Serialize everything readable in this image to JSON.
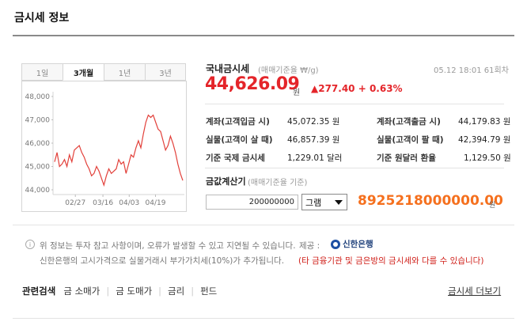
{
  "header": {
    "title": "금시세 정보"
  },
  "tabs": [
    {
      "label": "1일"
    },
    {
      "label": "3개월",
      "active": true
    },
    {
      "label": "1년"
    },
    {
      "label": "3년"
    }
  ],
  "chart_data": {
    "type": "line",
    "title": "",
    "xlabel": "",
    "ylabel": "",
    "ylim": [
      44000,
      48000
    ],
    "yticks": [
      "48,000",
      "47,000",
      "46,000",
      "45,000",
      "44,000"
    ],
    "xticks": [
      "02/27",
      "03/16",
      "04/03",
      "04/19"
    ],
    "color": "#e2403a",
    "series": [
      {
        "values": [
          45200,
          45600,
          45000,
          45100,
          45300,
          45000,
          45500,
          45200,
          45700,
          45800,
          45900,
          45600,
          45400,
          45100,
          44900,
          44600,
          44700,
          45000,
          44800,
          44500,
          44200,
          44600,
          44900,
          44700,
          44800,
          44900,
          45300,
          45100,
          45200,
          44700,
          45100,
          45500,
          45400,
          45800,
          46100,
          45800,
          46400,
          46900,
          47200,
          47100,
          47200,
          46900,
          46600,
          46500,
          46100,
          45700,
          45900,
          46300,
          46000,
          45600,
          45100,
          44700,
          44400
        ]
      }
    ]
  },
  "price": {
    "label": "국내금시세",
    "sub": "(매매기준율 ₩/g)",
    "timestamp": "05.12 18:01 61회차",
    "value": "44,626.09",
    "unit": "원",
    "change": "▲277.40 + 0.63%"
  },
  "details": [
    {
      "label": "계좌(고객입금 시)",
      "value": "45,072.35 원"
    },
    {
      "label": "계좌(고객출금 시)",
      "value": "44,179.83 원"
    },
    {
      "label": "실물(고객이 살 때)",
      "value": "46,857.39 원"
    },
    {
      "label": "실물(고객이 팔 때)",
      "value": "42,394.79 원"
    },
    {
      "label": "기준 국제 금시세",
      "value": "1,229.01 달러"
    },
    {
      "label": "기준 원달러 환율",
      "value": "1,129.50 원"
    }
  ],
  "calculator": {
    "title": "금값계산기",
    "sub": "(매매기준율 기준)",
    "input_value": "200000000",
    "unit_select": "그램",
    "result": "8925218000000.00",
    "result_unit": "원"
  },
  "notice": {
    "icon": "info-icon",
    "line1": "위 정보는 투자 참고 사항이며, 오류가 발생할 수 있고 지연될 수 있습니다.",
    "provider_label": "제공 :",
    "provider": "신한은행",
    "line2": "신한은행의 고시가격으로 실물거래시 부가가치세(10%)가 추가됩니다.",
    "line2_warning": "(타 금융기관 및 금은방의 금시세와 다를 수 있습니다)"
  },
  "related": {
    "title": "관련검색",
    "links": [
      "금 소매가",
      "금 도매가",
      "금리",
      "펀드"
    ],
    "more": "금시세 더보기"
  }
}
